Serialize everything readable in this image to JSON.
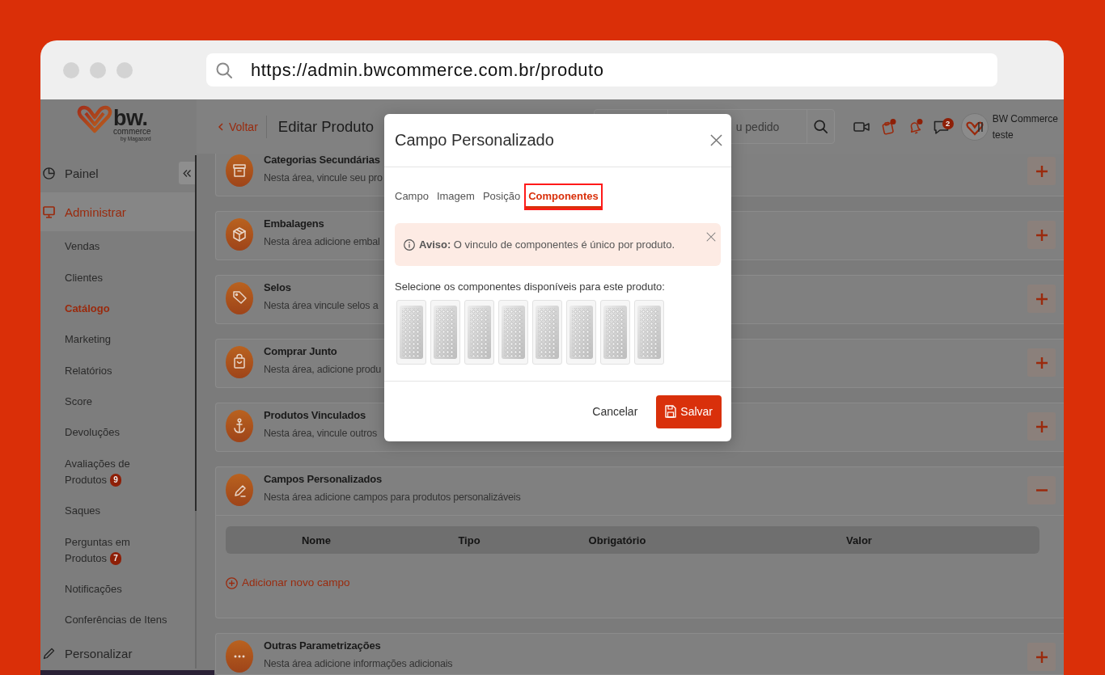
{
  "browser": {
    "url": "https://admin.bwcommerce.com.br/produto"
  },
  "sidebar": {
    "logo": {
      "wordmark": "bw.",
      "tagline": "commerce",
      "byline": "by Magazord"
    },
    "items": [
      {
        "label": "Painel",
        "selected": false
      },
      {
        "label": "Administrar",
        "selected": true,
        "children": [
          {
            "label": "Vendas",
            "selected": false
          },
          {
            "label": "Clientes",
            "selected": false
          },
          {
            "label": "Catálogo",
            "selected": true
          },
          {
            "label": "Marketing",
            "selected": false
          },
          {
            "label": "Relatórios",
            "selected": false
          },
          {
            "label": "Score",
            "selected": false
          },
          {
            "label": "Devoluções",
            "selected": false
          },
          {
            "label": "Avaliações de Produtos",
            "selected": false,
            "badge": "9"
          },
          {
            "label": "Saques",
            "selected": false
          },
          {
            "label": "Perguntas em Produtos",
            "selected": false,
            "badge": "7"
          },
          {
            "label": "Notificações",
            "selected": false
          },
          {
            "label": "Conferências de Itens",
            "selected": false
          }
        ]
      },
      {
        "label": "Personalizar",
        "selected": false
      }
    ]
  },
  "header": {
    "back_link": "Voltar",
    "title": "Editar Produto",
    "search": {
      "placeholder": "u pedido"
    },
    "icons": [
      {
        "alert": false
      },
      {
        "alert": true
      },
      {
        "alert": true
      },
      {
        "alert": false,
        "badge": "2"
      }
    ],
    "user": {
      "name": "BW Commerce",
      "subtitle": "teste"
    }
  },
  "sections": [
    {
      "title": "Categorias Secundárias",
      "description": "Nesta área, vincule seu pro",
      "expanded": false
    },
    {
      "title": "Embalagens",
      "description": "Nesta área adicione embal",
      "expanded": false
    },
    {
      "title": "Selos",
      "description": "Nesta área vincule selos a",
      "expanded": false
    },
    {
      "title": "Comprar Junto",
      "description": "Nesta área, adicione produ",
      "expanded": false
    },
    {
      "title": "Produtos Vinculados",
      "description": "Nesta área, vincule outros",
      "expanded": false
    },
    {
      "title": "Campos Personalizados",
      "description": "Nesta área adicione campos para produtos personalizáveis",
      "expanded": true,
      "table": {
        "columns": [
          "Nome",
          "Tipo",
          "Obrigatório",
          "Valor"
        ]
      },
      "add_link": "Adicionar novo campo"
    },
    {
      "title": "Outras Parametrizações",
      "description": "Nesta área adicione informações adicionais",
      "expanded": false
    }
  ],
  "modal": {
    "title": "Campo Personalizado",
    "tabs": [
      {
        "label": "Campo",
        "selected": false
      },
      {
        "label": "Imagem",
        "selected": false
      },
      {
        "label": "Posição",
        "selected": false
      },
      {
        "label": "Componentes",
        "selected": true
      }
    ],
    "alert": "**Aviso:** O vinculo de componentes é único por produto.",
    "prompt": "Selecione os componentes disponíveis para este produto:",
    "components": [
      {
        "selected": false
      },
      {
        "selected": false
      },
      {
        "selected": false
      },
      {
        "selected": false
      },
      {
        "selected": false
      },
      {
        "selected": false
      },
      {
        "selected": false
      },
      {
        "selected": false
      }
    ],
    "buttons": {
      "cancel": "Cancelar",
      "save": "Salvar"
    }
  }
}
